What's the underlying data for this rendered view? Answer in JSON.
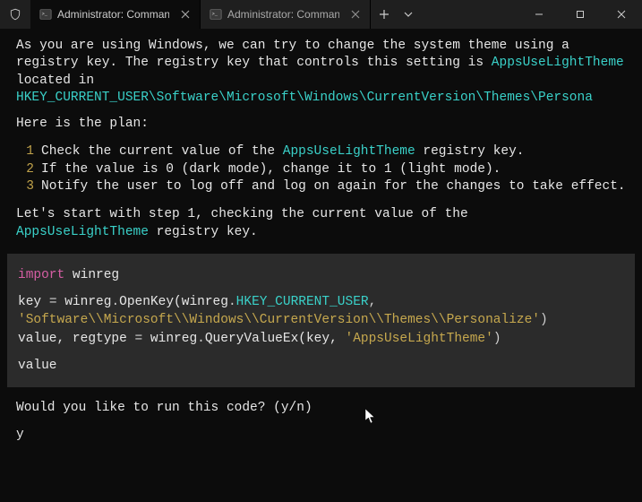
{
  "titlebar": {
    "tabs": [
      {
        "title": "Administrator: Command Pro",
        "active": true
      },
      {
        "title": "Administrator: Command Pron",
        "active": false
      }
    ]
  },
  "body": {
    "p1_a": "As you are using Windows, we can try to change the system theme using a registry key. The registry key that controls this setting is ",
    "p1_key": "AppsUseLightTheme",
    "p1_b": " located in ",
    "p1_path": "HKEY_CURRENT_USER\\Software\\Microsoft\\Windows\\CurrentVersion\\Themes\\Persona",
    "plan_intro": "Here is the plan:",
    "steps": [
      {
        "n": "1",
        "pre": "Check the current value of the ",
        "key": "AppsUseLightTheme",
        "post": " registry key."
      },
      {
        "n": "2",
        "pre": "If the value is 0 (dark mode), change it to 1 (light mode).",
        "key": "",
        "post": ""
      },
      {
        "n": "3",
        "pre": "Notify the user to log off and log on again for the changes to take effect.",
        "key": "",
        "post": ""
      }
    ],
    "p2_a": "Let's start with step 1, checking the current value of the ",
    "p2_key": "AppsUseLightTheme",
    "p2_b": " registry key."
  },
  "code": {
    "l1_import": "import",
    "l1_mod": " winreg",
    "l2_a": "key ",
    "l2_eq": "=",
    "l2_b": " winreg",
    "l2_dot1": ".",
    "l2_fn": "OpenKey(winreg",
    "l2_dot2": ".",
    "l2_const": "HKEY_CURRENT_USER",
    "l2_comma": ",",
    "l3_str": "'Software\\\\Microsoft\\\\Windows\\\\CurrentVersion\\\\Themes\\\\Personalize'",
    "l3_close": ")",
    "l4_a": "value, regtype ",
    "l4_eq": "=",
    "l4_b": " winreg",
    "l4_dot": ".",
    "l4_fn": "QueryValueEx(key, ",
    "l4_str": "'AppsUseLightTheme'",
    "l4_close": ")",
    "l5": "value"
  },
  "prompt": {
    "q": "Would you like to run this code? (y/n)",
    "a": "y"
  }
}
